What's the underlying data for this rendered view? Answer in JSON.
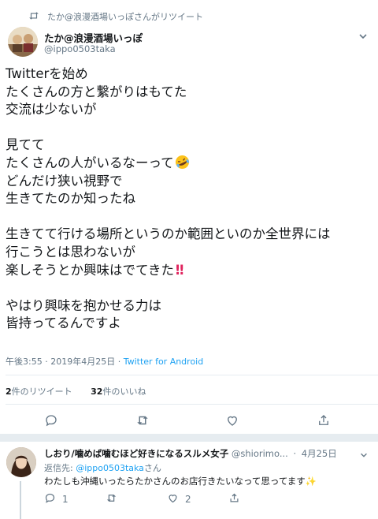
{
  "retweet_header": {
    "text": "たか@浪漫酒場いっぽさんがリツイート",
    "icon": "retweet-icon"
  },
  "tweet": {
    "author_name": "たか@浪漫酒場いっぽ",
    "author_handle": "@ippo0503taka",
    "paragraphs": [
      [
        "Twitterを始め",
        "たくさんの方と繋がりはもてた",
        "交流は少ないが"
      ],
      [
        "見てて",
        "たくさんの人がいるなーって",
        "どんだけ狭い視野で",
        "生きてたのか知ったね"
      ],
      [
        "生きてて行ける場所というのか範囲といのか全世界には",
        "行こうとは思わないが",
        "楽しそうとか興味はでてきた"
      ],
      [
        "やはり興味を抱かせる力は",
        "皆持ってるんですよ"
      ]
    ],
    "emoji_laugh": "rolling-on-the-floor-laughing-emoji",
    "emoji_bang": "‼",
    "time": "午後3:55",
    "date": "2019年4月25日",
    "separator": "·",
    "source": "Twitter for Android",
    "retweet_count": "2",
    "retweet_label": "件のリツイート",
    "like_count": "32",
    "like_label": "件のいいね"
  },
  "reply": {
    "author_name": "しおり/噛めば噛むほど好きになるスルメ女子",
    "author_handle": "@shiorimo...",
    "separator": "·",
    "date": "4月25日",
    "reply_prefix": "返信先: ",
    "reply_mention": "@ippo0503taka",
    "reply_suffix": "さん",
    "text": "わたしも沖縄いったらたかさんのお店行きたいなって思ってます",
    "sparkle": "✨",
    "reply_count": "1",
    "like_count": "2"
  },
  "colors": {
    "accent": "#1da1f2",
    "muted": "#657786",
    "divider": "#e6ecf0",
    "text": "#14171a"
  }
}
